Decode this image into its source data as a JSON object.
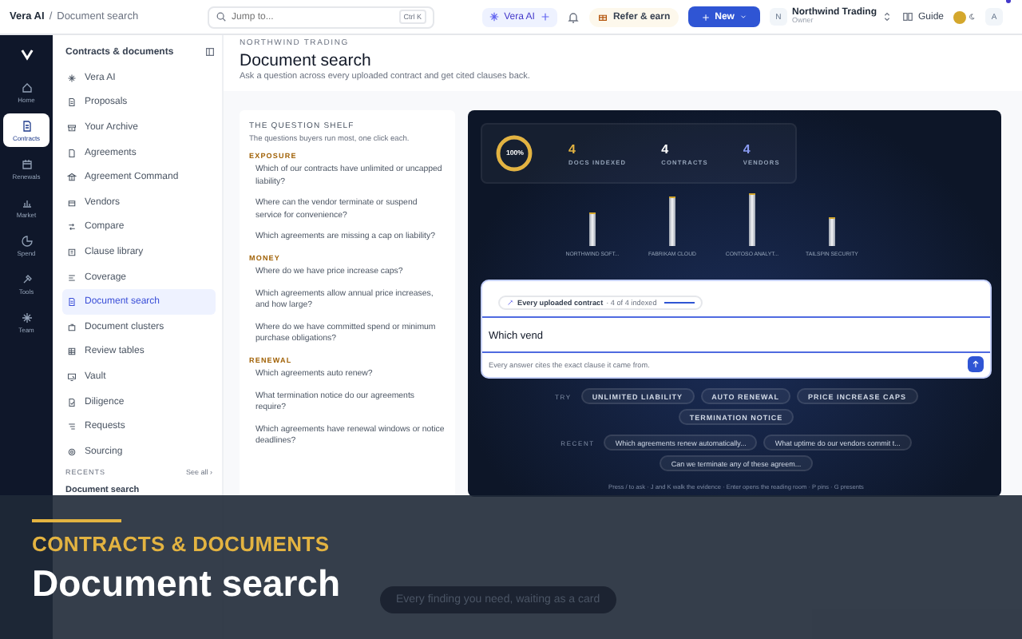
{
  "breadcrumb": [
    "Vera AI",
    "Document search"
  ],
  "breadcrumb_separator": "/",
  "search": {
    "placeholder": "Jump to...",
    "shortcut": "Ctrl K"
  },
  "topbar": {
    "ai_button": "Vera AI",
    "refer_button": "Refer & earn",
    "new_button": "New",
    "org": {
      "initial": "N",
      "name": "Northwind Trading",
      "role": "Owner"
    },
    "guide": "Guide",
    "avatar": "A",
    "notification_dot": true
  },
  "rail": [
    {
      "label": "Home",
      "selected": false
    },
    {
      "label": "Contracts",
      "selected": true
    },
    {
      "label": "Renewals",
      "selected": false
    },
    {
      "label": "Market",
      "selected": false
    },
    {
      "label": "Spend",
      "selected": false
    },
    {
      "label": "Tools",
      "selected": false
    },
    {
      "label": "Team",
      "selected": false
    }
  ],
  "sidebar": {
    "title": "Contracts & documents",
    "items": [
      {
        "label": "Vera AI",
        "selected": false
      },
      {
        "label": "Proposals",
        "selected": false
      },
      {
        "label": "Your Archive",
        "selected": false
      },
      {
        "label": "Agreements",
        "selected": false
      },
      {
        "label": "Agreement Command",
        "selected": false
      },
      {
        "label": "Vendors",
        "selected": false
      },
      {
        "label": "Compare",
        "selected": false
      },
      {
        "label": "Clause library",
        "selected": false
      },
      {
        "label": "Coverage",
        "selected": false
      },
      {
        "label": "Document search",
        "selected": true
      },
      {
        "label": "Document clusters",
        "selected": false
      },
      {
        "label": "Review tables",
        "selected": false
      },
      {
        "label": "Vault",
        "selected": false
      },
      {
        "label": "Diligence",
        "selected": false
      },
      {
        "label": "Requests",
        "selected": false
      },
      {
        "label": "Sourcing",
        "selected": false
      }
    ],
    "recents_label": "RECENTS",
    "see_all": "See all ›",
    "recents": [
      "Document search"
    ]
  },
  "page": {
    "eyebrow": "NORTHWIND TRADING",
    "title": "Document search",
    "subtitle": "Ask a question across every uploaded contract and get cited clauses back."
  },
  "shelf": {
    "title": "THE QUESTION SHELF",
    "subtitle": "The questions buyers run most, one click each.",
    "groups": [
      {
        "label": "EXPOSURE",
        "questions": [
          "Which of our contracts have unlimited or uncapped liability?",
          "Where can the vendor terminate or suspend service for convenience?",
          "Which agreements are missing a cap on liability?"
        ]
      },
      {
        "label": "MONEY",
        "questions": [
          "Where do we have price increase caps?",
          "Which agreements allow annual price increases, and how large?",
          "Where do we have committed spend or minimum purchase obligations?"
        ]
      },
      {
        "label": "RENEWAL",
        "questions": [
          "Which agreements auto renew?",
          "What termination notice do our agreements require?",
          "Which agreements have renewal windows or notice deadlines?"
        ]
      }
    ]
  },
  "panel": {
    "ring": {
      "label": "100%",
      "level": 1
    },
    "stats": [
      {
        "value": "4",
        "label": "DOCS INDEXED",
        "color": "#e3b341"
      },
      {
        "value": "4",
        "label": "CONTRACTS",
        "color": "#ffffff"
      },
      {
        "value": "4",
        "label": "VENDORS",
        "color": "#8b9cf4"
      }
    ],
    "vendors": [
      "NORTHWIND SOFT...",
      "FABRIKAM CLOUD",
      "CONTOSO ANALYT...",
      "TAILSPIN SECURITY"
    ],
    "scope": {
      "label": "Every uploaded contract",
      "status": "· 4 of 4 indexed",
      "level": 1
    },
    "query": {
      "value": "Which vend"
    },
    "note": "Every answer cites the exact clause it came from.",
    "try_label": "TRY",
    "suggestions": [
      "UNLIMITED LIABILITY",
      "AUTO RENEWAL",
      "PRICE INCREASE CAPS",
      "TERMINATION NOTICE"
    ],
    "recent_label": "RECENT",
    "recent": [
      "Which agreements renew automatically...",
      "What uptime do our vendors commit t...",
      "Can we terminate any of these agreem..."
    ],
    "hint": "Press / to ask · J and K walk the evidence · Enter opens the reading room · P pins · G presents"
  },
  "caption": {
    "eyebrow": "CONTRACTS & DOCUMENTS",
    "title": "Document search"
  },
  "toast": "Every finding you need, waiting as a card"
}
